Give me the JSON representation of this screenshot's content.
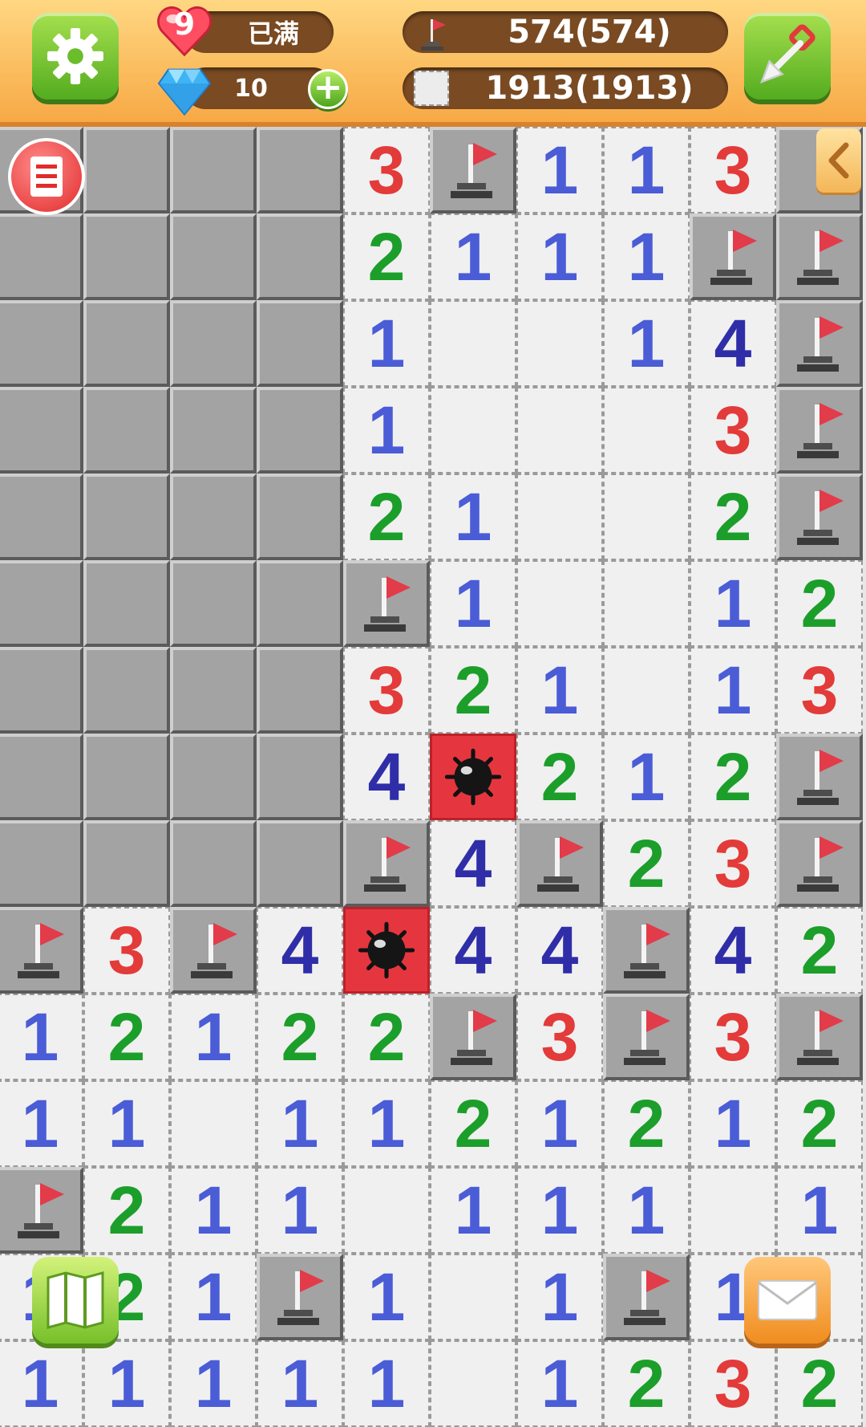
{
  "header": {
    "lives": "9",
    "lives_status": "已满",
    "gems": "10",
    "flags_count": "574(574)",
    "cells_count": "1913(1913)"
  },
  "colors": {
    "num1": "#4a5cd6",
    "num2": "#1c9e2a",
    "num3": "#e33a3a",
    "num4": "#2f2ea8",
    "mine_bg": "#e5363f",
    "closed": "#a3a3a3",
    "open": "#f0f0f0"
  },
  "icons": [
    "gear-icon",
    "heart-icon",
    "gem-icon",
    "plus-icon",
    "flag-icon",
    "empty-cell-icon",
    "shovel-icon",
    "menu-list-icon",
    "chevron-left-icon",
    "map-icon",
    "mail-icon",
    "mine-icon"
  ],
  "board": {
    "legend": "C=closed, F=flag, M=mine, .=open empty, digit=number",
    "rows": [
      "CCCC3F113C",
      "CCCC2111FF",
      "CCCC1..14F",
      "CCCC1...3F",
      "CCCC21..2F",
      "CCCCF1..12",
      "CCCC321.13",
      "CCCC4M212F",
      "CCCCF4F23F",
      "F3F4M44F42",
      "12122F3F3F",
      "11.1121212",
      "F211.111.1",
      "121F1.1F1.1",
      "11111.1232"
    ]
  }
}
